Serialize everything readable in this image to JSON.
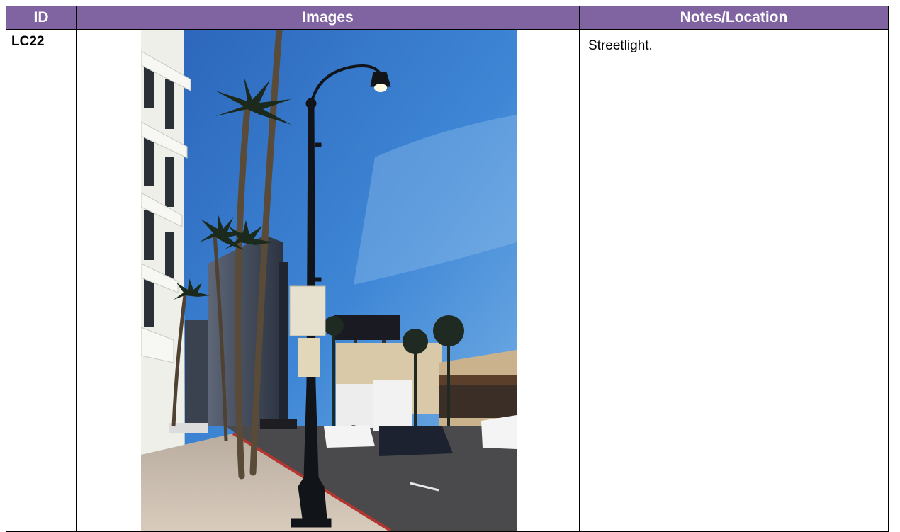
{
  "table": {
    "headers": {
      "id": "ID",
      "images": "Images",
      "notes": "Notes/Location"
    },
    "rows": [
      {
        "id": "LC22",
        "notes": "Streetlight."
      }
    ]
  },
  "colors": {
    "header_bg": "#8064a2",
    "header_text": "#ffffff",
    "border": "#000000"
  },
  "photo": {
    "subject": "streetlight-photo"
  }
}
